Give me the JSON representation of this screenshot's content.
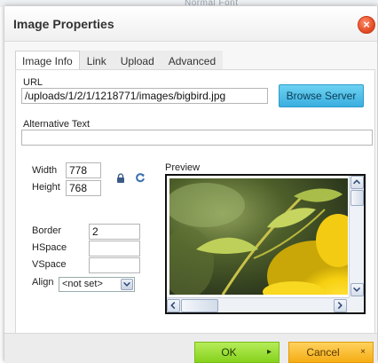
{
  "background_app": {
    "toolbar_text": "Normal    Font"
  },
  "dialog": {
    "title": "Image Properties",
    "close_glyph": "×",
    "tabs": [
      {
        "label": "Image Info",
        "active": true
      },
      {
        "label": "Link",
        "active": false
      },
      {
        "label": "Upload",
        "active": false
      },
      {
        "label": "Advanced",
        "active": false
      }
    ],
    "url": {
      "label": "URL",
      "value": "/uploads/1/2/1/1218771/images/bigbird.jpg",
      "browse_button": "Browse Server"
    },
    "alt_text": {
      "label": "Alternative Text",
      "value": ""
    },
    "width": {
      "label": "Width",
      "value": "778"
    },
    "height": {
      "label": "Height",
      "value": "768"
    },
    "border": {
      "label": "Border",
      "value": "2"
    },
    "hspace": {
      "label": "HSpace",
      "value": ""
    },
    "vspace": {
      "label": "VSpace",
      "value": ""
    },
    "align": {
      "label": "Align",
      "selected": "<not set>"
    },
    "preview": {
      "label": "Preview"
    },
    "footer": {
      "ok_button": "OK",
      "ok_icon": "▸",
      "cancel_button": "Cancel",
      "cancel_icon": "×"
    },
    "colors": {
      "ok_green": "#86d21c",
      "cancel_orange": "#f5ad14",
      "browse_blue": "#3aaee0",
      "close_red": "#e0461f"
    },
    "icons": [
      "close-icon",
      "lock-icon",
      "reset-size-icon",
      "scroll-up-icon",
      "scroll-down-icon",
      "scroll-left-icon",
      "scroll-right-icon",
      "dropdown-arrow-icon",
      "ok-arrow-icon",
      "cancel-x-icon"
    ]
  }
}
